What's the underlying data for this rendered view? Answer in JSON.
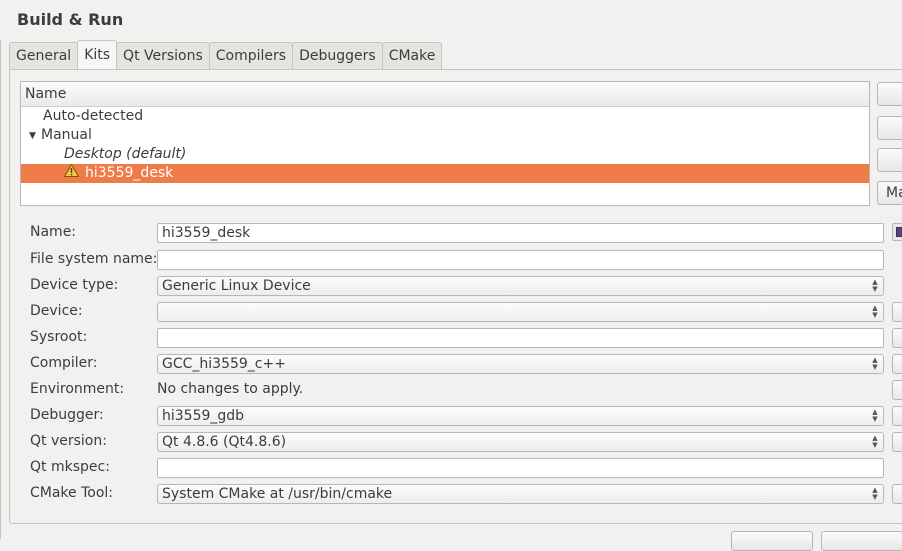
{
  "page": {
    "title": "Build & Run"
  },
  "tabs": [
    {
      "label": "General"
    },
    {
      "label": "Kits",
      "active": true
    },
    {
      "label": "Qt Versions"
    },
    {
      "label": "Compilers"
    },
    {
      "label": "Debuggers"
    },
    {
      "label": "CMake"
    }
  ],
  "kits_tree": {
    "header": "Name",
    "items": [
      {
        "label": "Auto-detected"
      },
      {
        "label": "Manual",
        "expanded": true
      },
      {
        "label": "Desktop (default)",
        "default": true
      },
      {
        "label": "hi3559_desk",
        "selected": true,
        "warning": true
      }
    ]
  },
  "side_buttons": [
    {
      "label": ""
    },
    {
      "label": ""
    },
    {
      "label": ""
    },
    {
      "label": "Ma"
    }
  ],
  "kit_form": {
    "name": {
      "label": "Name:",
      "value": "hi3559_desk"
    },
    "file_system_name": {
      "label": "File system name:",
      "value": ""
    },
    "device_type": {
      "label": "Device type:",
      "value": "Generic Linux Device"
    },
    "device": {
      "label": "Device:",
      "value": ""
    },
    "sysroot": {
      "label": "Sysroot:",
      "value": ""
    },
    "compiler": {
      "label": "Compiler:",
      "value": "GCC_hi3559_c++"
    },
    "environment": {
      "label": "Environment:",
      "value": "No changes to apply."
    },
    "debugger": {
      "label": "Debugger:",
      "value": "hi3559_gdb"
    },
    "qt_version": {
      "label": "Qt version:",
      "value": "Qt 4.8.6 (Qt4.8.6)"
    },
    "qt_mkspec": {
      "label": "Qt mkspec:",
      "value": ""
    },
    "cmake_tool": {
      "label": "CMake Tool:",
      "value": "System CMake at /usr/bin/cmake"
    }
  },
  "icons": {
    "warning": "warning-icon",
    "expand": "triangle-down-icon",
    "kit_icon": "device-icon"
  },
  "colors": {
    "selection": "#ef7b49",
    "text": "#3c3c3c",
    "background": "#f2f1f0"
  }
}
